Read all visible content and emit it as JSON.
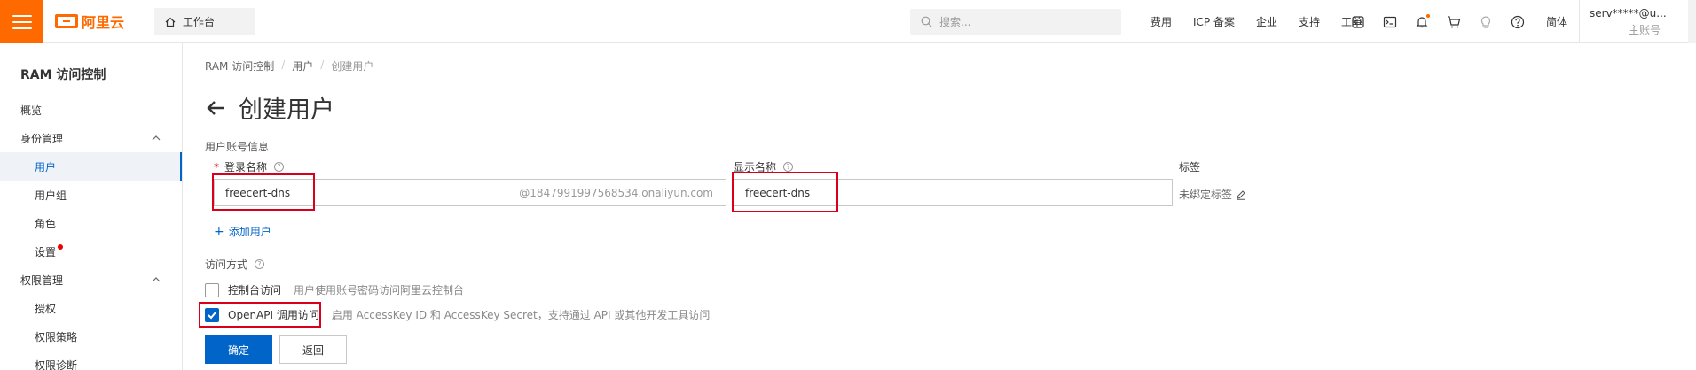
{
  "topbar": {
    "logo_text": "阿里云",
    "workbench": "工作台",
    "search_placeholder": "搜索...",
    "links": [
      "费用",
      "ICP 备案",
      "企业",
      "支持",
      "工单"
    ],
    "icons": [
      "code-icon",
      "terminal-icon",
      "bell-icon",
      "cart-icon",
      "bulb-icon",
      "help-icon"
    ],
    "lang": "简体",
    "account_name": "serv*****@u...",
    "account_role": "主账号"
  },
  "sidebar": {
    "title": "RAM 访问控制",
    "items": [
      {
        "label": "概览",
        "level": 1
      },
      {
        "label": "身份管理",
        "level": 1,
        "group": true
      },
      {
        "label": "用户",
        "level": 2,
        "active": true
      },
      {
        "label": "用户组",
        "level": 2
      },
      {
        "label": "角色",
        "level": 2
      },
      {
        "label": "设置",
        "level": 2,
        "dot": true
      },
      {
        "label": "权限管理",
        "level": 1,
        "group": true
      },
      {
        "label": "授权",
        "level": 2
      },
      {
        "label": "权限策略",
        "level": 2
      },
      {
        "label": "权限诊断",
        "level": 2
      }
    ]
  },
  "breadcrumb": [
    "RAM 访问控制",
    "用户",
    "创建用户"
  ],
  "page": {
    "title": "创建用户",
    "section_account": "用户账号信息",
    "login_label": "登录名称",
    "login_value": "freecert-dns",
    "login_suffix": "@1847991997568534.onaliyun.com",
    "display_label": "显示名称",
    "display_value": "freecert-dns",
    "tag_label": "标签",
    "tag_value": "未绑定标签",
    "add_user": "添加用户",
    "access_label": "访问方式",
    "console_label": "控制台访问",
    "console_desc": "用户使用账号密码访问阿里云控制台",
    "openapi_label": "OpenAPI 调用访问",
    "openapi_desc": "启用 AccessKey ID 和 AccessKey Secret，支持通过 API 或其他开发工具访问",
    "confirm": "确定",
    "back": "返回"
  },
  "colors": {
    "brand": "#ff6a00",
    "primary": "#0064c8",
    "highlight": "#d9001b"
  }
}
